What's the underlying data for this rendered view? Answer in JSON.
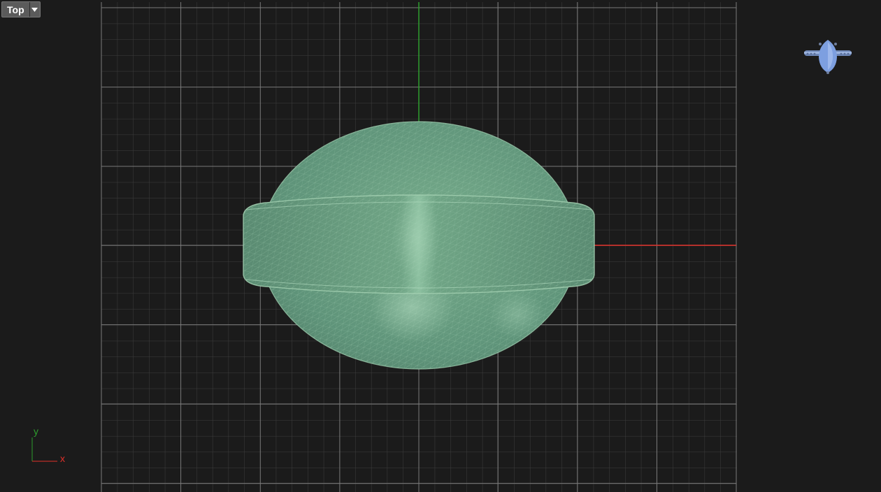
{
  "viewport": {
    "view_name": "Top",
    "view_menu_icon": "chevron-down-icon",
    "background_color": "#1b1b1b",
    "grid_color": "#4a4a4a",
    "grid_major_color": "#7a7a7a",
    "x_axis_color": "#e0302a",
    "y_axis_color": "#2e9e2e",
    "mesh_color": "#6a9f7e"
  },
  "axis_indicator": {
    "x_label": "x",
    "y_label": "y"
  },
  "thumbnail": {
    "icon": "ring-preview-icon"
  }
}
